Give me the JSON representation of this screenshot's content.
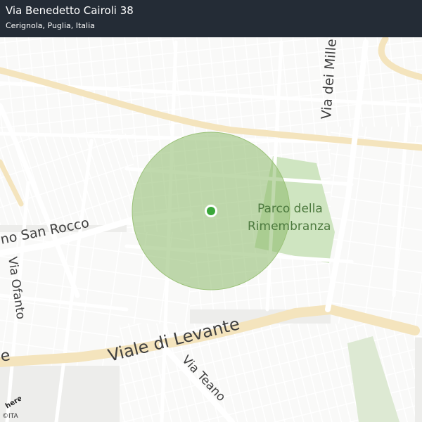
{
  "header": {
    "title": "Via Benedetto Cairoli 38",
    "subtitle": "Cerignola, Puglia, Italia"
  },
  "map": {
    "labels": {
      "via_dei_mille": "Via dei Mille",
      "parco_line1": "Parco della",
      "parco_line2": "Rimembranza",
      "san_rocco": "no  San Rocco",
      "via_ofanto": "Via Ofanto",
      "viale_levante": "Viale  di  Levante",
      "via_teano": "Via  Teano",
      "left_edge": "e"
    },
    "colors": {
      "background": "#ededeb",
      "block": "#f9f9f8",
      "street": "#ffffff",
      "major_road": "#f4e4bd",
      "park": "#cfe5c1",
      "radius": "#8dba6a",
      "marker": "#3aa73a",
      "header_bg": "#242c36"
    }
  },
  "attribution": {
    "logo": "here",
    "copyright": "©ITA"
  }
}
